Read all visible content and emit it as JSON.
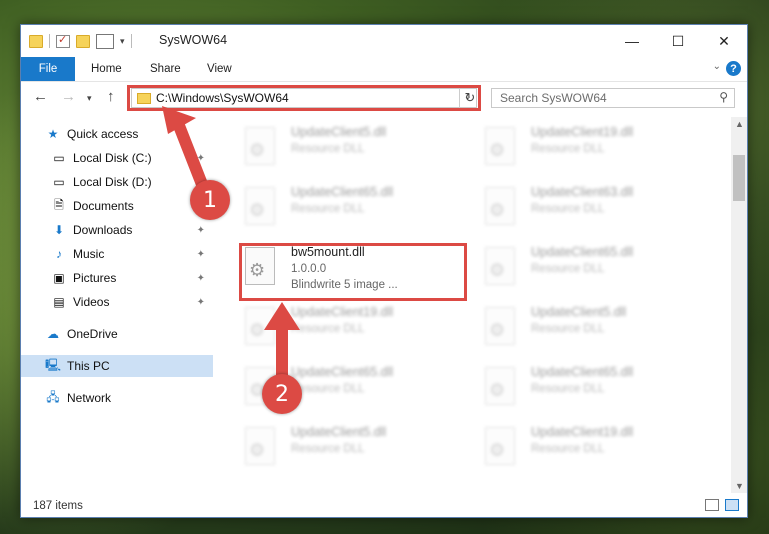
{
  "window": {
    "title": "SysWOW64",
    "controls": {
      "minimize": "—",
      "maximize": "☐",
      "close": "✕"
    }
  },
  "ribbon": {
    "tabs": [
      "File",
      "Home",
      "Share",
      "View"
    ],
    "help": "?"
  },
  "address_bar": {
    "path": "C:\\Windows\\SysWOW64",
    "refresh_glyph": "↻"
  },
  "search": {
    "placeholder": "Search SysWOW64"
  },
  "nav_pane": {
    "items": [
      {
        "label": "Quick access",
        "icon": "star-icon"
      },
      {
        "label": "Local Disk (C:)",
        "icon": "drive-icon",
        "pinned": true
      },
      {
        "label": "Local Disk (D:)",
        "icon": "drive-icon"
      },
      {
        "label": "Documents",
        "icon": "documents-icon"
      },
      {
        "label": "Downloads",
        "icon": "downloads-icon",
        "pinned": true
      },
      {
        "label": "Music",
        "icon": "music-icon",
        "pinned": true
      },
      {
        "label": "Pictures",
        "icon": "pictures-icon",
        "pinned": true
      },
      {
        "label": "Videos",
        "icon": "videos-icon",
        "pinned": true
      },
      {
        "label": "OneDrive",
        "icon": "onedrive-icon"
      },
      {
        "label": "This PC",
        "icon": "pc-icon",
        "selected": true
      },
      {
        "label": "Network",
        "icon": "network-icon"
      }
    ]
  },
  "files": {
    "highlighted": {
      "name": "bw5mount.dll",
      "version": "1.0.0.0",
      "description": "Blindwrite 5 image ..."
    },
    "blurred": [
      {
        "name": "UpdateClient5.dll",
        "type": "Resource DLL"
      },
      {
        "name": "UpdateClient19.dll",
        "type": "Resource DLL"
      },
      {
        "name": "UpdateClient65.dll",
        "type": "Resource DLL"
      },
      {
        "name": "UpdateClient63.dll",
        "type": "Resource DLL"
      },
      {
        "name": "UpdateClient65.dll",
        "type": "Resource DLL"
      },
      {
        "name": "UpdateClient19.dll",
        "type": "Resource DLL"
      },
      {
        "name": "UpdateClient5.dll",
        "type": "Resource DLL"
      },
      {
        "name": "UpdateClient65.dll",
        "type": "Resource DLL"
      },
      {
        "name": "UpdateClient65.dll",
        "type": "Resource DLL"
      },
      {
        "name": "UpdateClient5.dll",
        "type": "Resource DLL"
      },
      {
        "name": "UpdateClient19.dll",
        "type": "Resource DLL"
      }
    ]
  },
  "status": {
    "count": "187 items"
  },
  "annotations": {
    "step1": "1",
    "step2": "2"
  },
  "colors": {
    "accent": "#1979ca",
    "highlight": "#dc4a44",
    "selected": "#cce0f5"
  }
}
